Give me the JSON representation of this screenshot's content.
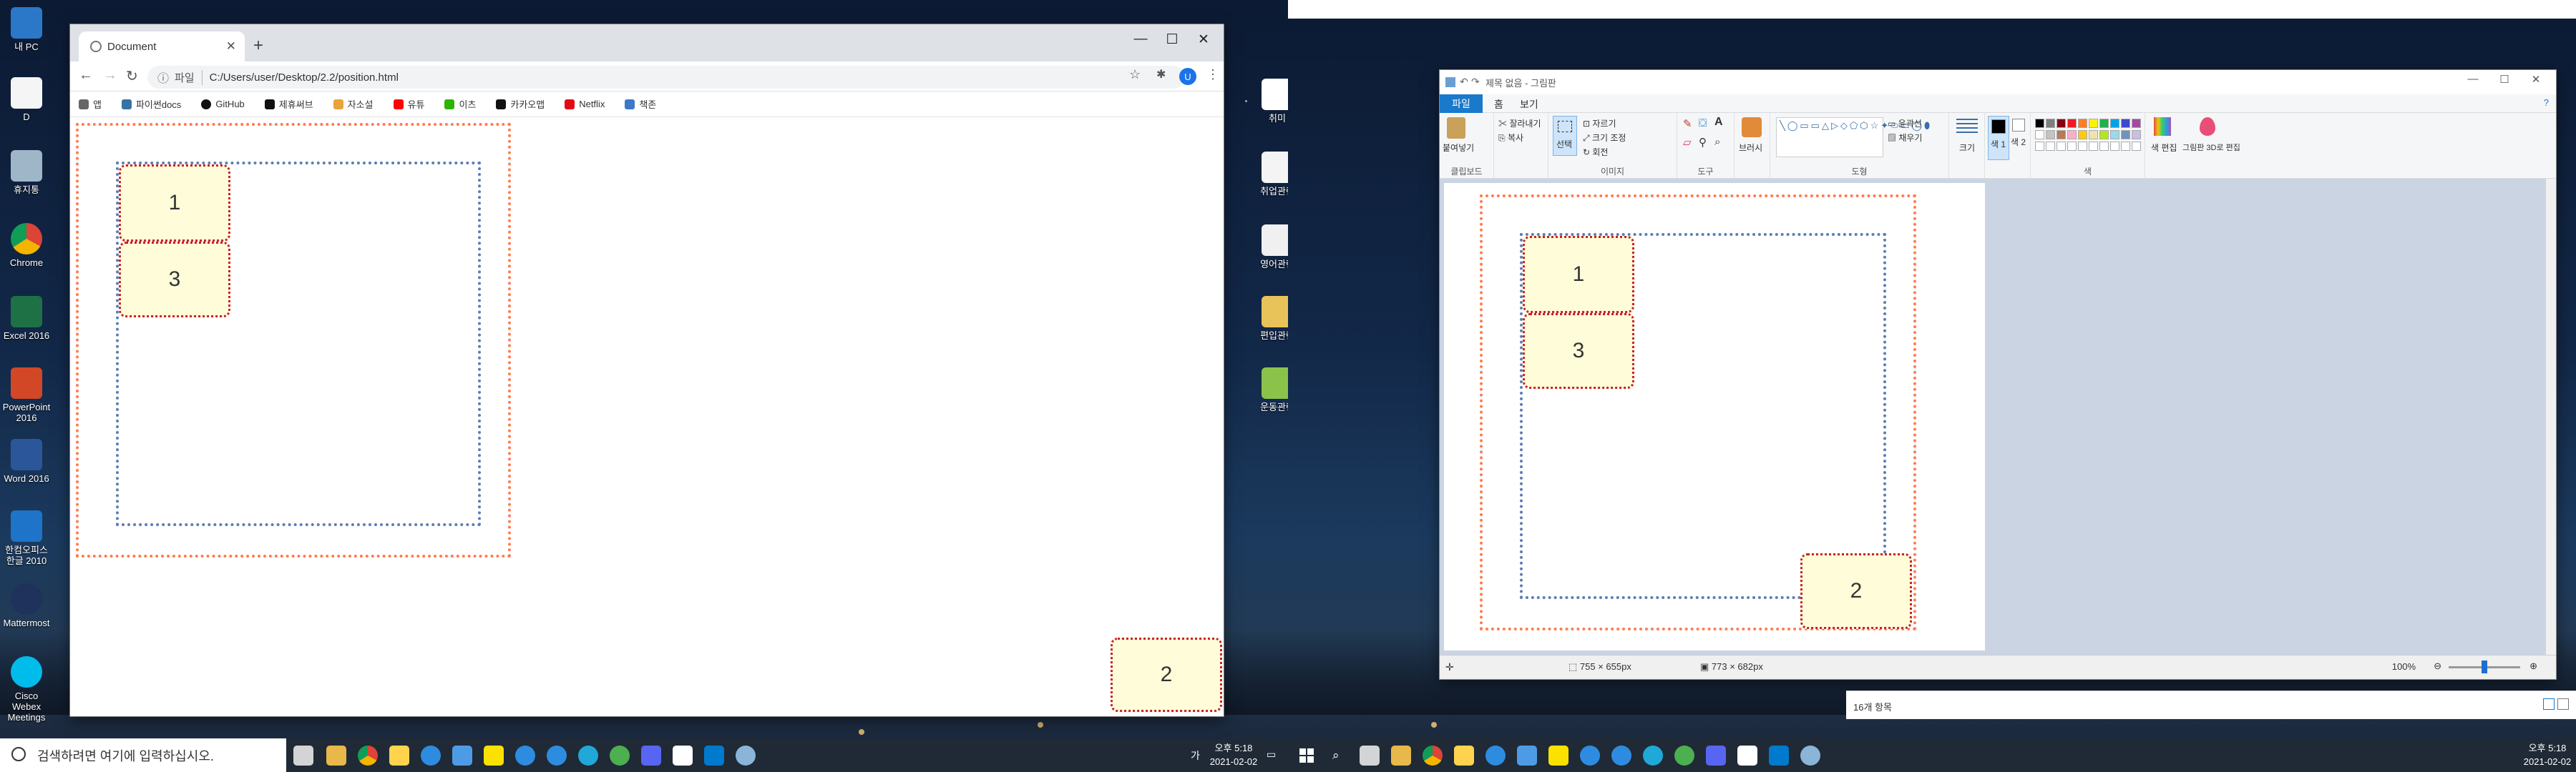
{
  "left_desktop": {
    "icons": [
      {
        "label": "내 PC"
      },
      {
        "label": "D"
      },
      {
        "label": "휴지통"
      },
      {
        "label": "Chrome"
      },
      {
        "label": "Excel 2016"
      },
      {
        "label": "PowerPoint 2016"
      },
      {
        "label": "Word 2016"
      },
      {
        "label": "한컴오피스 한글 2010"
      },
      {
        "label": "Mattermost"
      },
      {
        "label": "Cisco Webex Meetings"
      }
    ],
    "right_icons": [
      {
        "label": "취미"
      },
      {
        "label": "취업관련"
      },
      {
        "label": "영어관련"
      },
      {
        "label": "편입관련"
      },
      {
        "label": "운동관련"
      }
    ],
    "taskbar": {
      "search_placeholder": "검색하려면 여기에 입력하십시오.",
      "time": "오후 5:18",
      "date": "2021-02-02",
      "ime": "가",
      "ime2": "A"
    }
  },
  "chrome": {
    "tab_title": "Document",
    "address_label": "파일",
    "address": "C:/Users/user/Desktop/2.2/position.html",
    "profile_initial": "U",
    "bookmarks": [
      "앱",
      "파이썬docs",
      "GitHub",
      "제휴써브",
      "자소설",
      "유튜",
      "이츠",
      "카카오맵",
      "Netflix",
      "책존"
    ],
    "boxes": {
      "one": "1",
      "three": "3",
      "two": "2"
    }
  },
  "paint": {
    "title": "제목 없음 - 그림판",
    "menu": {
      "file": "파일",
      "home": "홈",
      "view": "보기"
    },
    "groups": {
      "clipboard": "클립보드",
      "image": "이미지",
      "tools": "도구",
      "shapes": "도형",
      "colors": "색"
    },
    "clipboard": {
      "paste": "붙여넣기",
      "cut": "잘라내기",
      "copy": "복사"
    },
    "image": {
      "select": "선택",
      "crop": "자르기",
      "resize": "크기 조정",
      "rotate": "회전"
    },
    "brushes": "브러시",
    "shape_outline": "윤곽선",
    "shape_fill": "채우기",
    "size": "크기",
    "color1": "색 1",
    "color2": "색 2",
    "edit_colors": "색 편집",
    "paint3d": "그림판 3D로 편집",
    "boxes": {
      "one": "1",
      "three": "3",
      "two": "2"
    },
    "status": {
      "selection_size": "755 × 655px",
      "image_size": "773 × 682px",
      "zoom": "100%"
    },
    "palette": [
      "#000000",
      "#7f7f7f",
      "#880015",
      "#ed1c24",
      "#ff7f27",
      "#fff200",
      "#22b14c",
      "#00a2e8",
      "#3f48cc",
      "#a349a4",
      "#ffffff",
      "#c3c3c3",
      "#b97a57",
      "#ffaec9",
      "#ffc90e",
      "#efe4b0",
      "#b5e61d",
      "#99d9ea",
      "#7092be",
      "#c8bfe7"
    ]
  },
  "explorer": {
    "item_count": "16개 항목"
  },
  "right_taskbar": {
    "time": "오후 5:18",
    "date": "2021-02-02"
  }
}
